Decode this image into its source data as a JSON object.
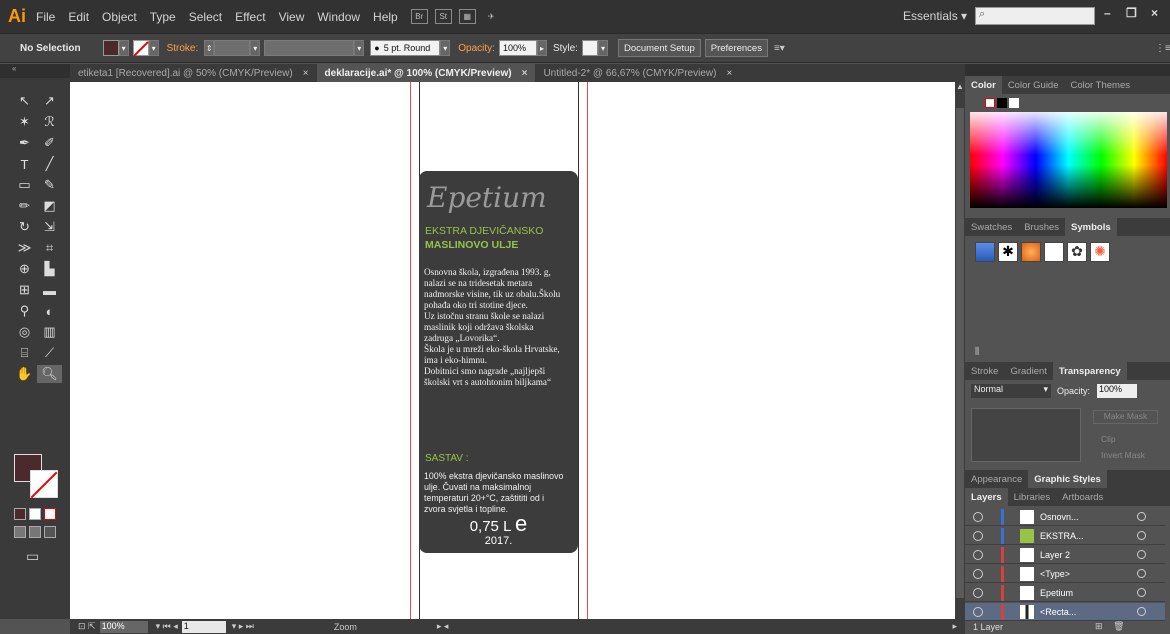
{
  "app": {
    "logo": "Ai",
    "menu": [
      "File",
      "Edit",
      "Object",
      "Type",
      "Select",
      "Effect",
      "View",
      "Window",
      "Help"
    ],
    "bridge_icons": [
      "Br",
      "St"
    ],
    "workspace": "Essentials",
    "search_placeholder": "",
    "window_controls": [
      "–",
      "❐",
      "×"
    ]
  },
  "control_bar": {
    "selection": "No Selection",
    "stroke_label": "Stroke:",
    "brush": "5 pt. Round",
    "opacity_label": "Opacity:",
    "opacity_value": "100%",
    "style_label": "Style:",
    "document_setup": "Document Setup",
    "preferences": "Preferences",
    "fill_color": "#4a2a2d"
  },
  "tabs": [
    {
      "label": "etiketa1 [Recovered].ai @ 50% (CMYK/Preview)",
      "close": "×",
      "active": false
    },
    {
      "label": "deklaracije.ai* @ 100% (CMYK/Preview)",
      "close": "×",
      "active": true
    },
    {
      "label": "Untitled-2* @ 66,67% (CMYK/Preview)",
      "close": "×",
      "active": false
    }
  ],
  "label": {
    "brand": "Epetium",
    "line1": "EKSTRA  DJEVIČANSKO",
    "line2": "MASLINOVO ULJE",
    "description": [
      "Osnovna škola, izgrađena 1993. g,",
      "nalazi se na tridesetak metara",
      "nadmorske visine, tik uz obalu.Školu",
      "pohađa oko tri stotine djece.",
      "Uz istočnu stranu škole se nalazi",
      "maslinik koji održava školska",
      "zadruga „Lovorika“.",
      "Škola je u mreži eko-škola Hrvatske,",
      "ima i eko-himnu.",
      "Dobitnici smo nagrade „najljepši",
      "školski vrt s autohtonim biljkama“"
    ],
    "sastav_title": "SASTAV :",
    "sastav_text": [
      "100% ekstra djevičansko maslinovo",
      "ulje. Čuvati na maksimalnoj",
      "temperaturi 20+°C, zaštititi od i",
      "zvora svjetla i topline."
    ],
    "volume": "0,75 L",
    "estimated_mark": "e",
    "year": "2017.",
    "card_color": "#3c3c3c",
    "accent_green": "#95c447"
  },
  "status_bar": {
    "zoom": "100%",
    "page": "1",
    "mode": "Zoom"
  },
  "panels": {
    "color_tabs": [
      "Color",
      "Color Guide",
      "Color Themes"
    ],
    "swatch_tabs": [
      "Swatches",
      "Brushes",
      "Symbols"
    ],
    "transparency_tabs": [
      "Stroke",
      "Gradient",
      "Transparency"
    ],
    "blend_mode": "Normal",
    "opacity_label": "Opacity:",
    "opacity_value": "100%",
    "make_mask": "Make Mask",
    "clip": "Clip",
    "invert_mask": "Invert Mask",
    "appearance_tabs": [
      "Appearance",
      "Graphic Styles"
    ],
    "layers_tabs": [
      "Layers",
      "Libraries",
      "Artboards"
    ],
    "layers": [
      {
        "name": "Osnovn...",
        "color": "#3a6fd8"
      },
      {
        "name": "EKSTRA...",
        "color": "#3a6fd8"
      },
      {
        "name": "Layer 2",
        "color": "#d84040"
      },
      {
        "name": "<Type>",
        "color": "#d84040"
      },
      {
        "name": "Epetium",
        "color": "#d84040"
      },
      {
        "name": "<Recta...",
        "color": "#d84040"
      }
    ],
    "layer_count": "1 Layer"
  }
}
